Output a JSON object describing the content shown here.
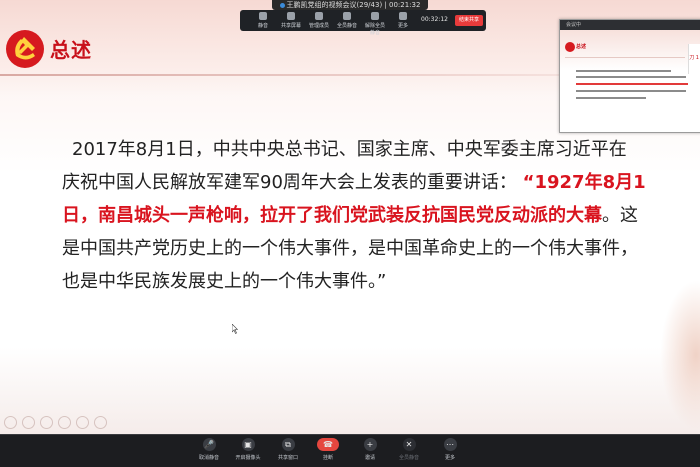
{
  "window": {
    "title": "王鹏凯党组的视频会议(29/43)",
    "elapsed": "00:21:32"
  },
  "meeting_toolbar": {
    "items": [
      "静音",
      "共享屏幕",
      "管理成员",
      "全员静音",
      "解除全员静音",
      "更多"
    ],
    "timer": "00:32:12",
    "end_label": "结束共享"
  },
  "slide": {
    "title": "总述",
    "paragraph_lines": [
      "2017年8月1日，中共中央总书记、国家主席、中央军委主席习近平在",
      "庆祝中国人民解放军建军90周年大会上发表的重要讲话："
    ],
    "quote_part1": "“1927年8月1",
    "quote_part2": "日，南昌城头一声枪响，拉开了我们党武装反抗国民党反动派的大幕",
    "after_quote": "。这",
    "line3": "是中国共产党历史上的一个伟大事件，是中国革命史上的一个伟大事件，",
    "line4": "也是中华民族发展史上的一个伟大事件。”"
  },
  "pip": {
    "header": "会议中",
    "title": "总述",
    "side_text": "刀 1"
  },
  "bottom_toolbar": {
    "items": [
      {
        "label": "取消静音",
        "icon": "microphone-icon",
        "enabled": true
      },
      {
        "label": "开启摄像头",
        "icon": "camera-icon",
        "enabled": true
      },
      {
        "label": "共享窗口",
        "icon": "share-window-icon",
        "enabled": true
      },
      {
        "label": "挂断",
        "icon": "hang-up-icon",
        "enabled": true
      },
      {
        "label": "邀请",
        "icon": "invite-icon",
        "enabled": true
      },
      {
        "label": "全员静音",
        "icon": "mute-all-icon",
        "enabled": false
      },
      {
        "label": "更多",
        "icon": "more-icon",
        "enabled": true
      }
    ]
  },
  "colors": {
    "accent_red": "#d9141f",
    "toolbar_bg": "#1c1d20",
    "end_call_red": "#e5473f"
  }
}
